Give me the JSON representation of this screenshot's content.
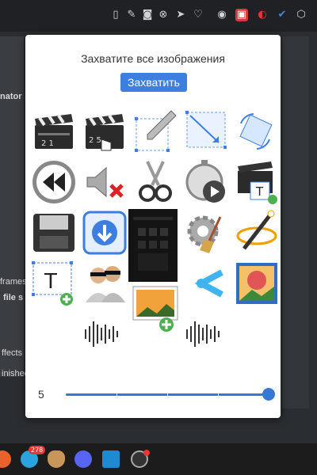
{
  "popup": {
    "title": "Захватите все изображения",
    "capture_label": "Захватить",
    "slider": {
      "value": "5",
      "level": 1.0
    }
  },
  "background": {
    "text_1": "nator",
    "text_2": "frames",
    "text_3": "file s",
    "text_4": "ffects",
    "text_5": "inished"
  },
  "taskbar": {
    "telegram_badge": "278"
  },
  "colors": {
    "accent": "#3d7fe0",
    "toolbar": "#202124",
    "popup_bg": "#ffffff"
  }
}
